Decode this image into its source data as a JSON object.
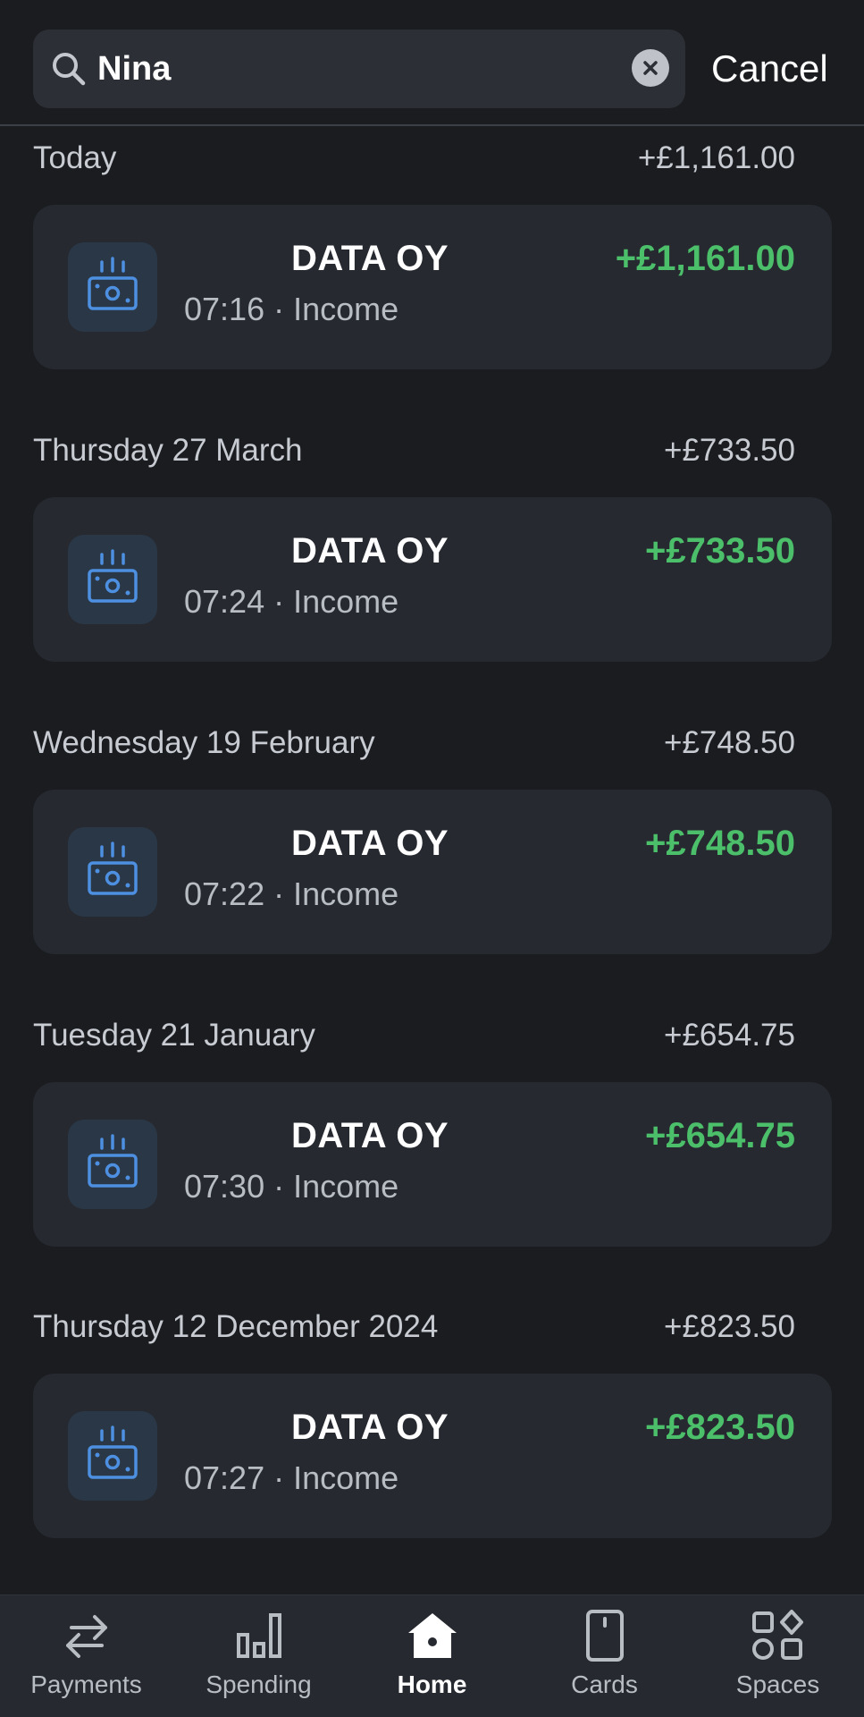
{
  "search": {
    "query": "Nina",
    "cancel_label": "Cancel"
  },
  "groups": [
    {
      "date": "Today",
      "total": "+£1,161.00",
      "transaction": {
        "name": "DATA OY",
        "meta": "07:16 · Income",
        "amount": "+£1,161.00"
      }
    },
    {
      "date": "Thursday 27 March",
      "total": "+£733.50",
      "transaction": {
        "name": "DATA OY",
        "meta": "07:24 · Income",
        "amount": "+£733.50"
      }
    },
    {
      "date": "Wednesday 19 February",
      "total": "+£748.50",
      "transaction": {
        "name": "DATA OY",
        "meta": "07:22 · Income",
        "amount": "+£748.50"
      }
    },
    {
      "date": "Tuesday 21 January",
      "total": "+£654.75",
      "transaction": {
        "name": "DATA OY",
        "meta": "07:30 · Income",
        "amount": "+£654.75"
      }
    },
    {
      "date": "Thursday 12 December 2024",
      "total": "+£823.50",
      "transaction": {
        "name": "DATA OY",
        "meta": "07:27 · Income",
        "amount": "+£823.50"
      }
    }
  ],
  "nav": {
    "items": [
      {
        "label": "Payments",
        "icon": "payments-arrows-icon",
        "active": false
      },
      {
        "label": "Spending",
        "icon": "bar-chart-icon",
        "active": false
      },
      {
        "label": "Home",
        "icon": "home-icon",
        "active": true
      },
      {
        "label": "Cards",
        "icon": "card-icon",
        "active": false
      },
      {
        "label": "Spaces",
        "icon": "spaces-icon",
        "active": false
      }
    ]
  },
  "colors": {
    "background": "#1a1c20",
    "card": "#262930",
    "income_green": "#4cbf6a",
    "icon_blue": "#4d8fe0"
  }
}
